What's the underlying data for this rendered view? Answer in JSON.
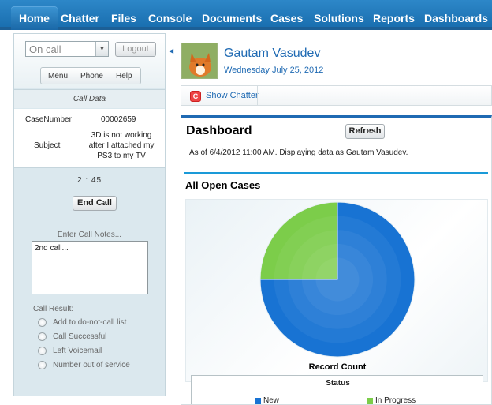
{
  "nav": {
    "tabs": [
      "Home",
      "Chatter",
      "Files",
      "Console",
      "Documents",
      "Cases",
      "Solutions",
      "Reports",
      "Dashboards"
    ]
  },
  "softphone": {
    "status_value": "On call",
    "logout_label": "Logout",
    "menu_items": [
      "Menu",
      "Phone",
      "Help"
    ],
    "call_data_header": "Call Data",
    "case_number_label": "CaseNumber",
    "case_number_value": "00002659",
    "subject_label": "Subject",
    "subject_value": "3D is not working after I attached my PS3 to my TV",
    "timer": "2 : 45",
    "end_call_label": "End Call",
    "notes_label": "Enter Call Notes...",
    "notes_value": "2nd call...",
    "result_label": "Call Result:",
    "results": [
      "Add to do-not-call list",
      "Call Successful",
      "Left Voicemail",
      "Number out of service"
    ]
  },
  "profile": {
    "name": "Gautam Vasudev",
    "date": "Wednesday July 25, 2012"
  },
  "chatter": {
    "show_label": "Show Chatter"
  },
  "dashboard": {
    "title": "Dashboard",
    "refresh_label": "Refresh",
    "as_of": "As of 6/4/2012 11:00 AM. Displaying data as Gautam Vasudev.",
    "component_title": "All Open Cases"
  },
  "colors": {
    "new": "#1873d3",
    "in_progress": "#7ccd4a"
  },
  "chart_data": {
    "type": "pie",
    "xlabel": "Record Count",
    "legend_title": "Status",
    "legend_position": "bottom",
    "series": [
      {
        "name": "New",
        "value": 3
      },
      {
        "name": "In Progress",
        "value": 1
      }
    ]
  }
}
